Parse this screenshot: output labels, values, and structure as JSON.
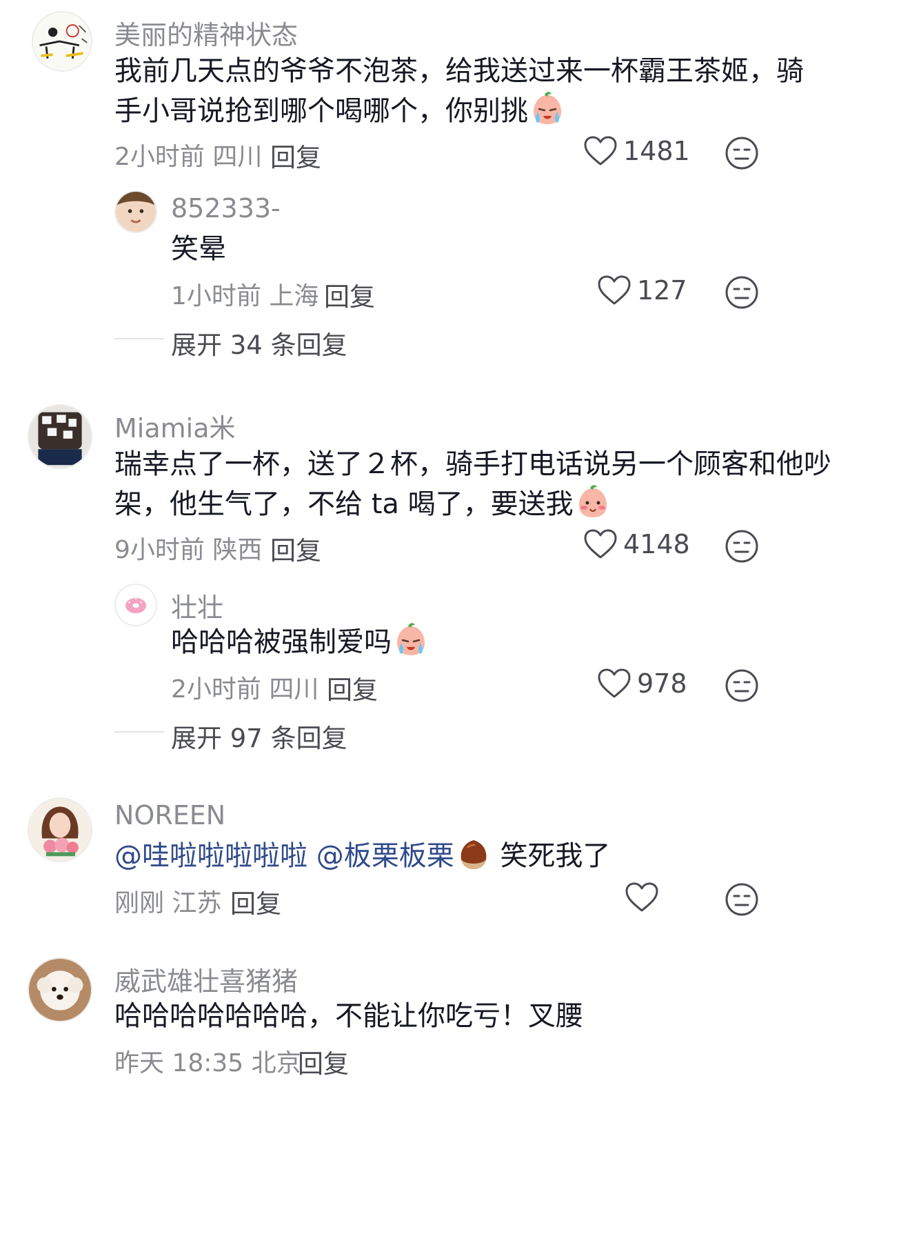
{
  "comments": [
    {
      "username": "美丽的精神状态",
      "text_line1": "我前几天点的爷爷不泡茶，给我送过来一杯霸王茶姬，骑",
      "text_line2": "手小哥说抢到哪个喝哪个，你别挑",
      "emoji": "crying-face-emoji",
      "time": "2小时前",
      "location": "四川",
      "reply_label": "回复",
      "likes": "1481",
      "replies": [
        {
          "username": "852333-",
          "text": "笑晕",
          "time": "1小时前",
          "location": "上海",
          "reply_label": "回复",
          "likes": "127"
        }
      ],
      "expand_label": "展开 34 条回复"
    },
    {
      "username": "Miamia米",
      "text_line1": "瑞幸点了一杯，送了２杯，骑手打电话说另一个顾客和他吵",
      "text_line2": "架，他生气了，不给 ta 喝了，要送我",
      "emoji": "blushing-face-emoji",
      "time": "9小时前",
      "location": "陕西",
      "reply_label": "回复",
      "likes": "4148",
      "replies": [
        {
          "username": "壮壮",
          "text": "哈哈哈被强制爱吗",
          "emoji": "crying-face-emoji",
          "time": "2小时前",
          "location": "四川",
          "reply_label": "回复",
          "likes": "978"
        }
      ],
      "expand_label": "展开 97 条回复"
    },
    {
      "username": "NOREEN",
      "mention1": "@哇啦啦啦啦啦",
      "mention2": "@板栗板栗",
      "text_after": "笑死我了",
      "emoji": "chestnut-emoji",
      "time": "刚刚",
      "location": "江苏",
      "reply_label": "回复",
      "likes": ""
    },
    {
      "username": "威武雄壮喜猪猪",
      "text_line1": "哈哈哈哈哈哈哈，不能让你吃亏！叉腰",
      "time": "昨天 18:35",
      "location": "北京",
      "reply_label": "回复"
    }
  ],
  "colors": {
    "username": "#8a8b91",
    "text": "#161823",
    "mention": "#2f4a8a",
    "action": "#4a4b52"
  }
}
